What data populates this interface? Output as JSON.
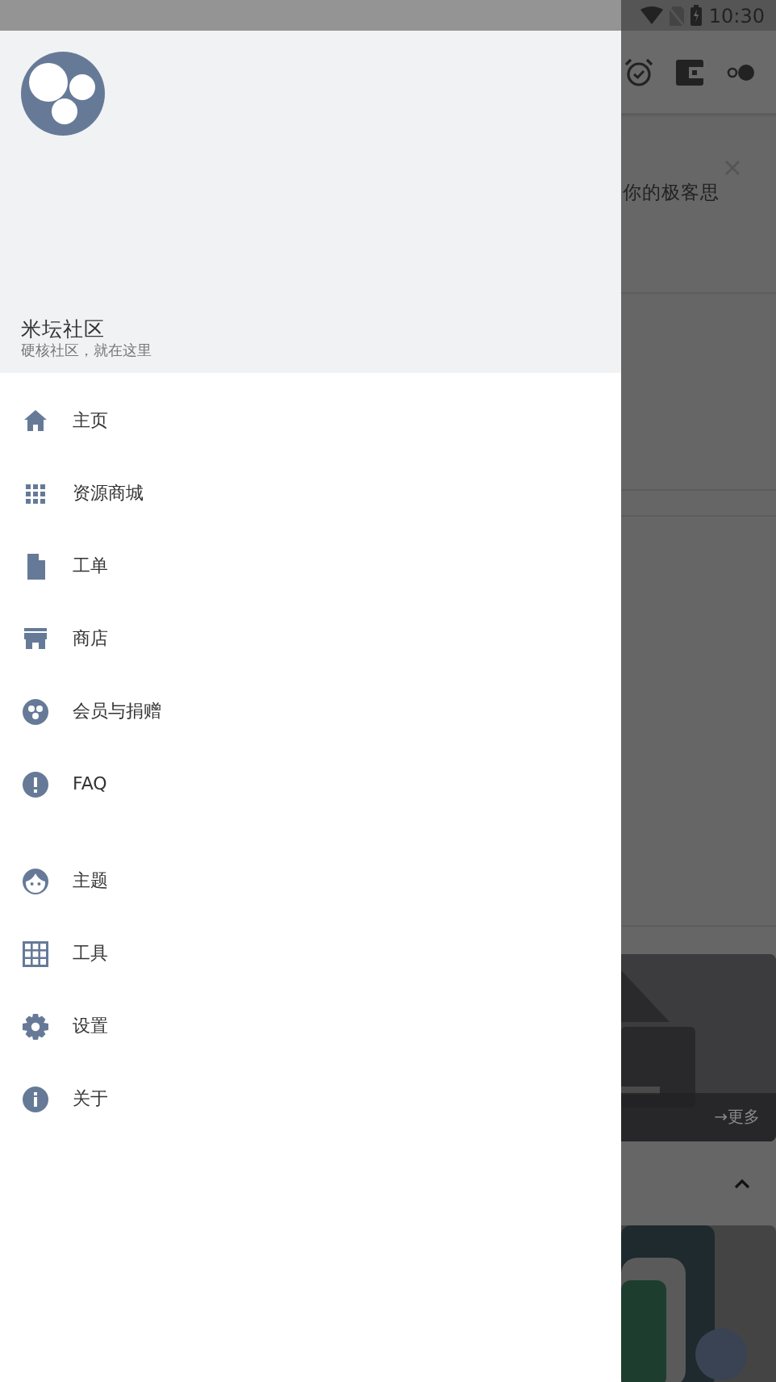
{
  "status_bar": {
    "time": "10:30"
  },
  "drawer": {
    "title": "米坛社区",
    "subtitle": "硬核社区，就在这里",
    "sections": [
      [
        {
          "label": "主页"
        },
        {
          "label": "资源商城"
        },
        {
          "label": "工单"
        },
        {
          "label": "商店"
        },
        {
          "label": "会员与捐赠"
        },
        {
          "label": "FAQ"
        }
      ],
      [
        {
          "label": "主题"
        },
        {
          "label": "工具"
        },
        {
          "label": "设置"
        },
        {
          "label": "关于"
        }
      ]
    ]
  },
  "background_app": {
    "notice": {
      "text": "你的极客思"
    },
    "banner": {
      "more": "→更多"
    }
  }
}
